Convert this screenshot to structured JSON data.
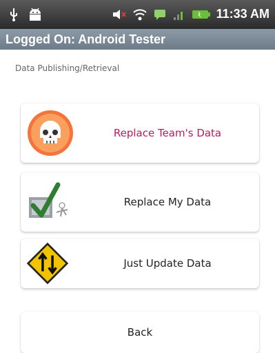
{
  "status_bar": {
    "time": "11:33 AM",
    "icons": [
      "usb-icon",
      "android-debug-icon",
      "speaker-icon",
      "wifi-icon",
      "message-icon",
      "signal-icon",
      "battery-icon"
    ]
  },
  "title_bar": {
    "title": "Logged On: Android Tester"
  },
  "section": {
    "label": "Data Publishing/Retrieval"
  },
  "actions": [
    {
      "label": "Replace Team's Data",
      "icon": "skull-icon",
      "color": "#c2185b"
    },
    {
      "label": "Replace My Data",
      "icon": "checkmark-icon"
    },
    {
      "label": "Just Update Data",
      "icon": "arrows-sign-icon"
    }
  ],
  "back": {
    "label": "Back"
  },
  "colors": {
    "status_bar": "#2b2b2b",
    "title_bar": "#6d7b89",
    "accent": "#c2185b"
  }
}
